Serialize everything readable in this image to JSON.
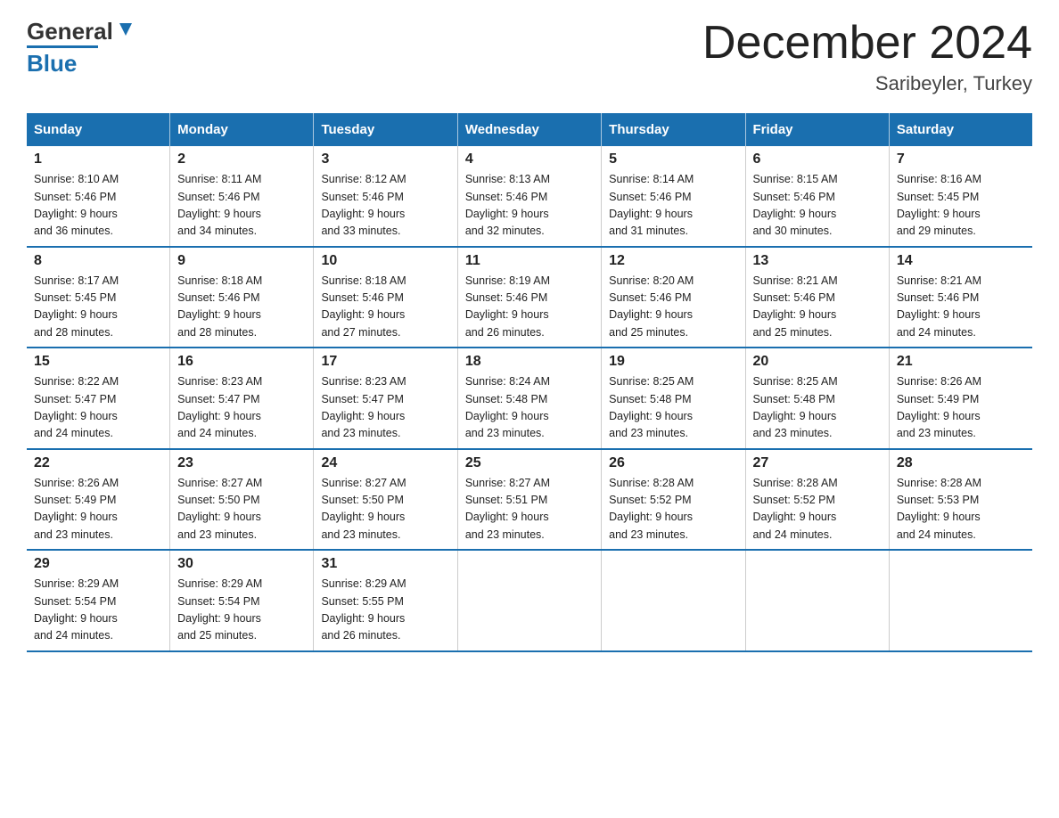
{
  "header": {
    "title": "December 2024",
    "subtitle": "Saribeyler, Turkey",
    "logo_general": "General",
    "logo_blue": "Blue"
  },
  "days_of_week": [
    "Sunday",
    "Monday",
    "Tuesday",
    "Wednesday",
    "Thursday",
    "Friday",
    "Saturday"
  ],
  "weeks": [
    [
      {
        "num": "1",
        "sunrise": "8:10 AM",
        "sunset": "5:46 PM",
        "daylight": "9 hours and 36 minutes."
      },
      {
        "num": "2",
        "sunrise": "8:11 AM",
        "sunset": "5:46 PM",
        "daylight": "9 hours and 34 minutes."
      },
      {
        "num": "3",
        "sunrise": "8:12 AM",
        "sunset": "5:46 PM",
        "daylight": "9 hours and 33 minutes."
      },
      {
        "num": "4",
        "sunrise": "8:13 AM",
        "sunset": "5:46 PM",
        "daylight": "9 hours and 32 minutes."
      },
      {
        "num": "5",
        "sunrise": "8:14 AM",
        "sunset": "5:46 PM",
        "daylight": "9 hours and 31 minutes."
      },
      {
        "num": "6",
        "sunrise": "8:15 AM",
        "sunset": "5:46 PM",
        "daylight": "9 hours and 30 minutes."
      },
      {
        "num": "7",
        "sunrise": "8:16 AM",
        "sunset": "5:45 PM",
        "daylight": "9 hours and 29 minutes."
      }
    ],
    [
      {
        "num": "8",
        "sunrise": "8:17 AM",
        "sunset": "5:45 PM",
        "daylight": "9 hours and 28 minutes."
      },
      {
        "num": "9",
        "sunrise": "8:18 AM",
        "sunset": "5:46 PM",
        "daylight": "9 hours and 28 minutes."
      },
      {
        "num": "10",
        "sunrise": "8:18 AM",
        "sunset": "5:46 PM",
        "daylight": "9 hours and 27 minutes."
      },
      {
        "num": "11",
        "sunrise": "8:19 AM",
        "sunset": "5:46 PM",
        "daylight": "9 hours and 26 minutes."
      },
      {
        "num": "12",
        "sunrise": "8:20 AM",
        "sunset": "5:46 PM",
        "daylight": "9 hours and 25 minutes."
      },
      {
        "num": "13",
        "sunrise": "8:21 AM",
        "sunset": "5:46 PM",
        "daylight": "9 hours and 25 minutes."
      },
      {
        "num": "14",
        "sunrise": "8:21 AM",
        "sunset": "5:46 PM",
        "daylight": "9 hours and 24 minutes."
      }
    ],
    [
      {
        "num": "15",
        "sunrise": "8:22 AM",
        "sunset": "5:47 PM",
        "daylight": "9 hours and 24 minutes."
      },
      {
        "num": "16",
        "sunrise": "8:23 AM",
        "sunset": "5:47 PM",
        "daylight": "9 hours and 24 minutes."
      },
      {
        "num": "17",
        "sunrise": "8:23 AM",
        "sunset": "5:47 PM",
        "daylight": "9 hours and 23 minutes."
      },
      {
        "num": "18",
        "sunrise": "8:24 AM",
        "sunset": "5:48 PM",
        "daylight": "9 hours and 23 minutes."
      },
      {
        "num": "19",
        "sunrise": "8:25 AM",
        "sunset": "5:48 PM",
        "daylight": "9 hours and 23 minutes."
      },
      {
        "num": "20",
        "sunrise": "8:25 AM",
        "sunset": "5:48 PM",
        "daylight": "9 hours and 23 minutes."
      },
      {
        "num": "21",
        "sunrise": "8:26 AM",
        "sunset": "5:49 PM",
        "daylight": "9 hours and 23 minutes."
      }
    ],
    [
      {
        "num": "22",
        "sunrise": "8:26 AM",
        "sunset": "5:49 PM",
        "daylight": "9 hours and 23 minutes."
      },
      {
        "num": "23",
        "sunrise": "8:27 AM",
        "sunset": "5:50 PM",
        "daylight": "9 hours and 23 minutes."
      },
      {
        "num": "24",
        "sunrise": "8:27 AM",
        "sunset": "5:50 PM",
        "daylight": "9 hours and 23 minutes."
      },
      {
        "num": "25",
        "sunrise": "8:27 AM",
        "sunset": "5:51 PM",
        "daylight": "9 hours and 23 minutes."
      },
      {
        "num": "26",
        "sunrise": "8:28 AM",
        "sunset": "5:52 PM",
        "daylight": "9 hours and 23 minutes."
      },
      {
        "num": "27",
        "sunrise": "8:28 AM",
        "sunset": "5:52 PM",
        "daylight": "9 hours and 24 minutes."
      },
      {
        "num": "28",
        "sunrise": "8:28 AM",
        "sunset": "5:53 PM",
        "daylight": "9 hours and 24 minutes."
      }
    ],
    [
      {
        "num": "29",
        "sunrise": "8:29 AM",
        "sunset": "5:54 PM",
        "daylight": "9 hours and 24 minutes."
      },
      {
        "num": "30",
        "sunrise": "8:29 AM",
        "sunset": "5:54 PM",
        "daylight": "9 hours and 25 minutes."
      },
      {
        "num": "31",
        "sunrise": "8:29 AM",
        "sunset": "5:55 PM",
        "daylight": "9 hours and 26 minutes."
      },
      null,
      null,
      null,
      null
    ]
  ],
  "labels": {
    "sunrise": "Sunrise:",
    "sunset": "Sunset:",
    "daylight": "Daylight:"
  }
}
